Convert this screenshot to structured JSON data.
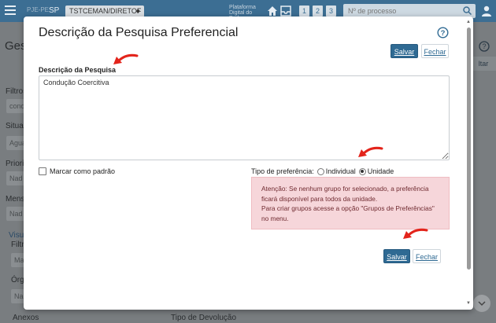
{
  "topbar": {
    "logo_text": "PJE-PE",
    "state": "SP",
    "unit_select": "TSTCEMAN/DIRETOF",
    "platform_text": "Plataforma Digital do Poder Judiciário",
    "shortcuts": [
      "1",
      "2",
      "3"
    ],
    "process_placeholder": "Nº de processo"
  },
  "background": {
    "heading": "Ges",
    "labels": [
      "Filtros",
      "Situaç",
      "Priori",
      "Mensa",
      "Filtr",
      "Órg",
      "Anexos",
      "Tipo de Devolução"
    ],
    "fields": [
      "cond",
      "Agua",
      "Nad",
      "Nad",
      "Ma",
      "Na"
    ],
    "link": "Visua",
    "right_button": "ltar"
  },
  "modal": {
    "title": "Descrição da Pesquisa Preferencial",
    "save_label": "Salvar",
    "close_label": "Fechar",
    "description_label": "Descrição da Pesquisa",
    "description_value": "Condução Coercitiva",
    "default_checkbox_label": "Marcar como padrão",
    "default_checked": false,
    "preference_label": "Tipo de preferência:",
    "option_individual": "Individual",
    "option_unit": "Unidade",
    "selected_option": "Unidade",
    "alert_text_1": "Atenção: Se nenhum grupo for selecionado, a preferência ficará disponível para todos da unidade.",
    "alert_text_2": "Para criar grupos acesse a opção \"Grupos de Preferências\" no menu."
  },
  "colors": {
    "primary": "#2f6a93",
    "topbar": "#3c6e93",
    "alert_bg": "#f6d6da",
    "annotation_arrow": "#e3241b"
  },
  "icons": [
    "menu-icon",
    "home-icon",
    "inbox-icon",
    "search-icon",
    "user-icon",
    "help-icon",
    "caret-down-icon",
    "annotation-arrow-icon"
  ]
}
